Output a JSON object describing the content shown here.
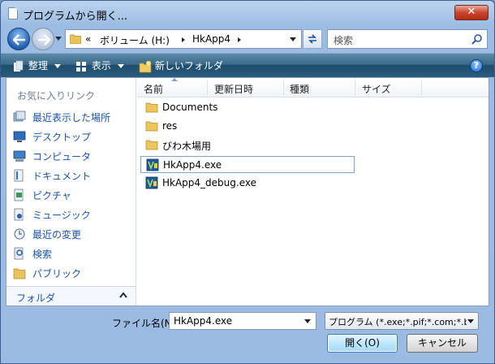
{
  "window": {
    "title": "プログラムから開く...",
    "close_label": "✕"
  },
  "nav": {
    "address_prefix": "«",
    "address_segments": [
      "ボリューム (H:)",
      "HkApp4"
    ],
    "search_placeholder": "検索"
  },
  "toolbar": {
    "organize_label": "整理",
    "views_label": "表示",
    "new_folder_label": "新しいフォルダ",
    "help_label": "?"
  },
  "sidebar": {
    "favorites_header": "お気に入りリンク",
    "items": [
      {
        "label": "最近表示した場所",
        "icon": "recent-places-icon"
      },
      {
        "label": "デスクトップ",
        "icon": "desktop-icon"
      },
      {
        "label": "コンピュータ",
        "icon": "computer-icon"
      },
      {
        "label": "ドキュメント",
        "icon": "documents-icon"
      },
      {
        "label": "ピクチャ",
        "icon": "pictures-icon"
      },
      {
        "label": "ミュージック",
        "icon": "music-icon"
      },
      {
        "label": "最近の変更",
        "icon": "recently-changed-icon"
      },
      {
        "label": "検索",
        "icon": "searches-icon"
      },
      {
        "label": "パブリック",
        "icon": "public-icon"
      }
    ],
    "folders_label": "フォルダ"
  },
  "file_list": {
    "columns": [
      "名前",
      "更新日時",
      "種類",
      "サイズ"
    ],
    "items": [
      {
        "name": "Documents",
        "type": "folder"
      },
      {
        "name": "res",
        "type": "folder"
      },
      {
        "name": "びわ木場用",
        "type": "folder"
      },
      {
        "name": "HkApp4.exe",
        "type": "exe",
        "selected": true
      },
      {
        "name": "HkApp4_debug.exe",
        "type": "exe"
      }
    ]
  },
  "footer": {
    "filename_label": "ファイル名(N):",
    "filename_value": "HkApp4.exe",
    "filetype_value": "プログラム (*.exe;*.pif;*.com;*.bat;*",
    "open_label": "開く(O)",
    "cancel_label": "キャンセル"
  },
  "colors": {
    "toolbar": "#2a5c7d",
    "link": "#1a54a8",
    "selection_border": "#7da2ce"
  }
}
